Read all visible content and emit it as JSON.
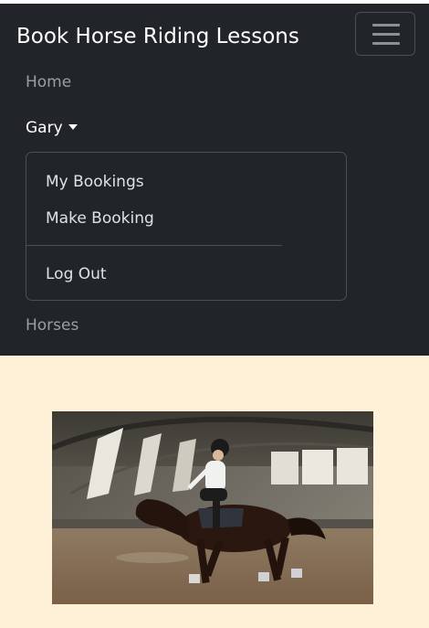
{
  "navbar": {
    "brand": "Book Horse Riding Lessons",
    "toggler_icon": "hamburger-menu-icon",
    "links": {
      "home": "Home",
      "user": "Gary",
      "horses": "Horses"
    },
    "dropdown": {
      "items": [
        "My Bookings",
        "Make Booking",
        "Log Out"
      ]
    },
    "colors": {
      "background": "#212529",
      "link": "#9a9da1",
      "active": "#ffffff"
    }
  },
  "main": {
    "background": "#fef1d8",
    "hero_image": "horse-rider-indoor-arena-photo"
  }
}
